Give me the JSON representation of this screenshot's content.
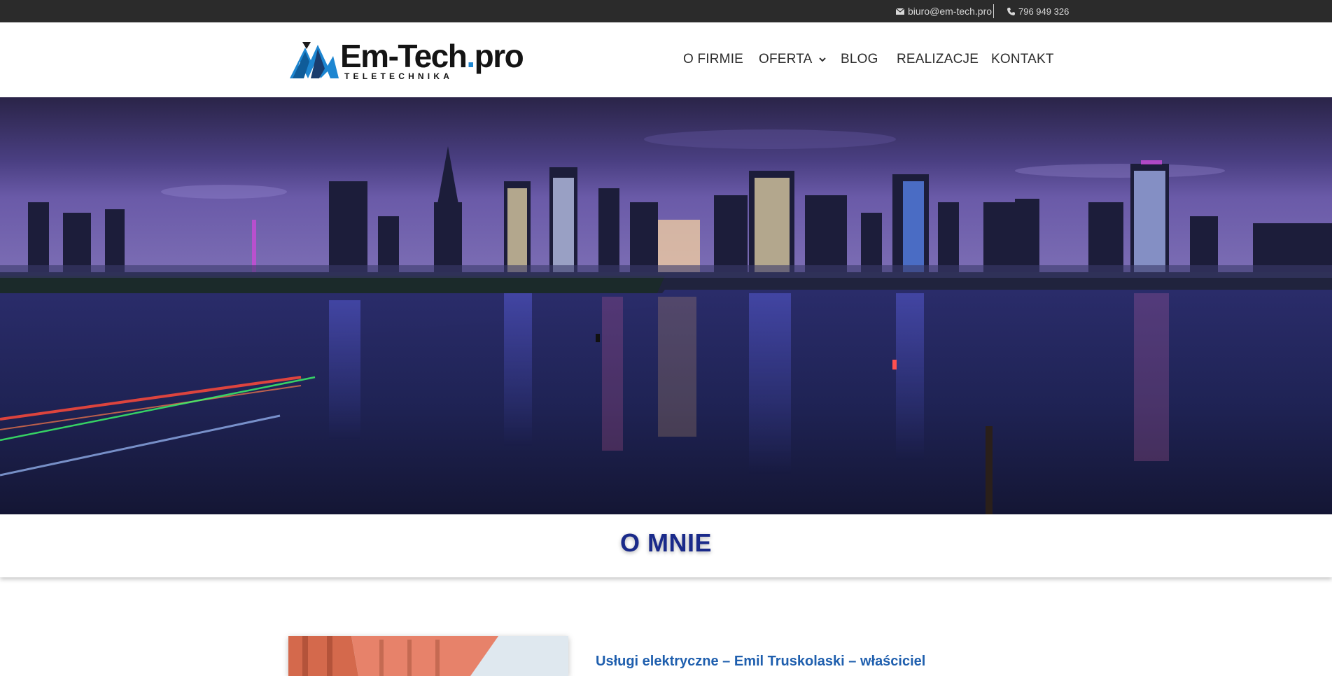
{
  "topbar": {
    "email": "biuro@em-tech.pro",
    "email_icon": "envelope-icon",
    "phone": "796 949 326",
    "phone_icon": "phone-icon"
  },
  "header": {
    "logo": {
      "name_main": "Em-Tech",
      "name_dot": ".",
      "name_tld": "pro",
      "tagline": "TELETECHNIKA",
      "mark_icon": "mountain-logo-icon"
    },
    "nav": [
      {
        "label": "O FIRMIE"
      },
      {
        "label": "OFERTA",
        "has_dropdown": true
      },
      {
        "label": "BLOG"
      },
      {
        "label": "REALIZACJE"
      },
      {
        "label": "KONTAKT"
      }
    ]
  },
  "hero": {
    "image": "night-city-skyline-river"
  },
  "page": {
    "title": "O MNIE"
  },
  "content": {
    "owner_heading": "Usługi elektryczne – Emil Truskolaski – właściciel"
  },
  "colors": {
    "topbar_bg": "#2b2b2b",
    "title_color": "#1a2a8a",
    "heading_color": "#1f5fae",
    "logo_accent": "#1d86d1"
  }
}
